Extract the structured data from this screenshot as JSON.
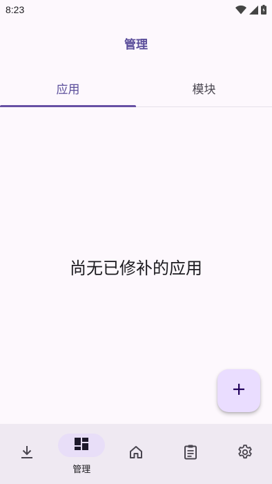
{
  "status_bar": {
    "time": "8:23",
    "icons": [
      "wifi-icon",
      "signal-icon",
      "battery-icon"
    ]
  },
  "app_bar": {
    "title": "管理"
  },
  "tabs": [
    {
      "label": "应用",
      "active": true
    },
    {
      "label": "模块",
      "active": false
    }
  ],
  "empty_state": {
    "text": "尚无已修补的应用"
  },
  "fab": {
    "icon": "add-icon"
  },
  "bottom_nav": [
    {
      "icon": "download-icon",
      "active": false
    },
    {
      "icon": "dashboard-icon",
      "label": "管理",
      "active": true
    },
    {
      "icon": "home-icon",
      "active": false
    },
    {
      "icon": "clipboard-icon",
      "active": false
    },
    {
      "icon": "settings-icon",
      "active": false
    }
  ],
  "colors": {
    "background": "#fdf8fd",
    "accent": "#6750a4",
    "title": "#5a4d9a",
    "fab": "#eaddff",
    "nav_background": "#efe9f2",
    "nav_active_indicator": "#e8def8"
  }
}
